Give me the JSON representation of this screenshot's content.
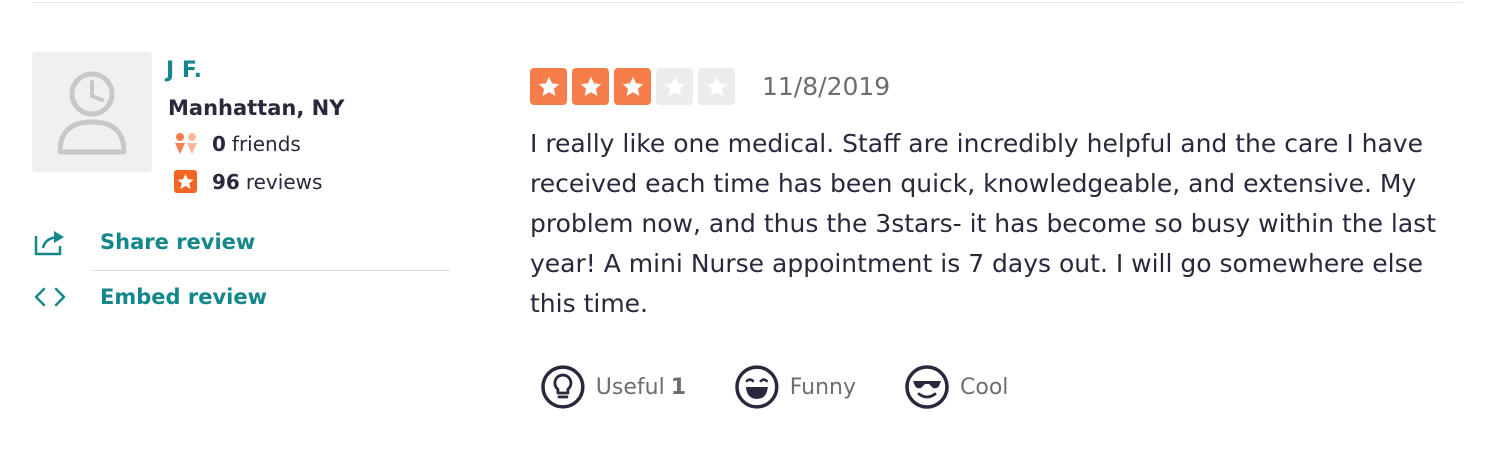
{
  "reviewer": {
    "name": "J F.",
    "location": "Manhattan, NY",
    "friends_count": "0",
    "friends_label": "friends",
    "reviews_count": "96",
    "reviews_label": "reviews"
  },
  "actions": {
    "share_label": "Share review",
    "embed_label": "Embed review"
  },
  "review": {
    "rating": 3,
    "max_rating": 5,
    "date": "11/8/2019",
    "text": "I really like one medical. Staff are incredibly helpful and the care I have received each time has been quick, knowledgeable, and extensive. My problem now, and thus the 3stars- it has become so busy within the last year! A mini Nurse appointment is 7 days out.  I will go somewhere else this time."
  },
  "votes": {
    "useful_label": "Useful",
    "useful_count": "1",
    "funny_label": "Funny",
    "cool_label": "Cool"
  },
  "colors": {
    "accent": "#14878b",
    "star_on": "#f77e4a",
    "star_off": "#ececec",
    "text": "#2b273c",
    "muted": "#6e6e6e"
  },
  "icons": [
    "default-avatar-icon",
    "friends-icon",
    "reviews-star-icon",
    "share-icon",
    "embed-code-icon",
    "star-icon",
    "useful-bulb-icon",
    "funny-face-icon",
    "cool-sunglasses-icon"
  ]
}
